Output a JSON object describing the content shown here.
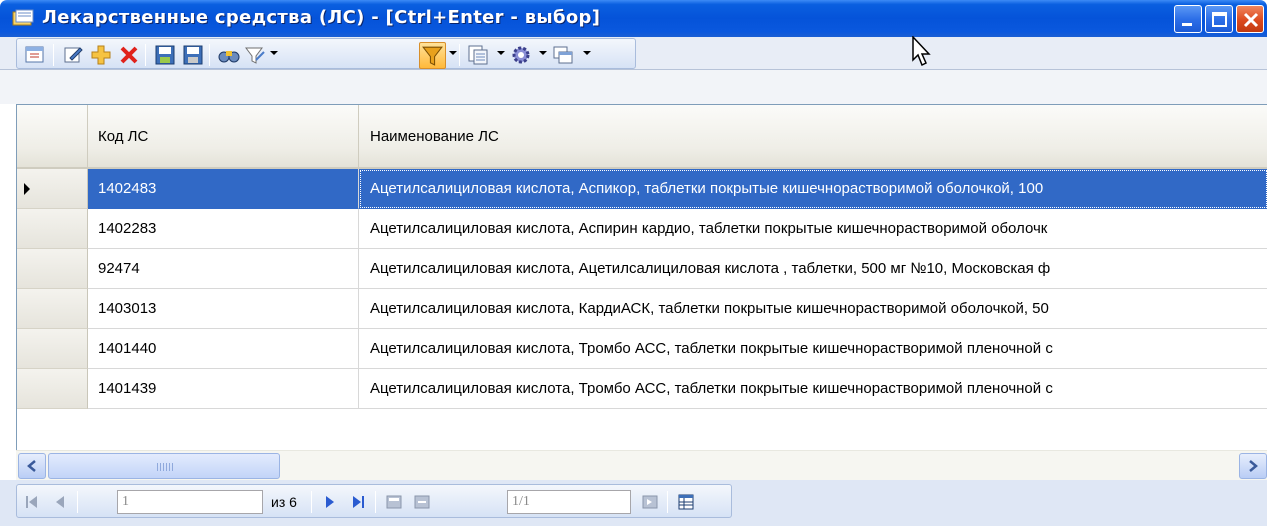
{
  "window": {
    "title": "Лекарственные средства (ЛС) - [Ctrl+Enter - выбор]"
  },
  "toolbar": {
    "items": [
      "refresh-icon",
      "edit-icon",
      "add-icon",
      "delete-icon",
      "save-icon",
      "save-as-icon",
      "find-icon",
      "filter-edit-icon",
      "filter-icon",
      "copy-icon",
      "settings-icon",
      "windows-icon"
    ],
    "filter_active": true
  },
  "grid": {
    "columns": [
      "Код ЛС",
      "Наименование ЛС"
    ],
    "selected_row": 0,
    "rows": [
      {
        "code": "1402483",
        "name": "Ацетилсалициловая кислота, Аспикор, таблетки покрытые кишечнорастворимой оболочкой, 100"
      },
      {
        "code": "1402283",
        "name": "Ацетилсалициловая кислота, Аспирин кардио, таблетки покрытые кишечнорастворимой оболочк"
      },
      {
        "code": "92474",
        "name": "Ацетилсалициловая кислота, Ацетилсалициловая кислота , таблетки, 500 мг №10, Московская ф"
      },
      {
        "code": "1403013",
        "name": "Ацетилсалициловая кислота, КардиАСК, таблетки покрытые кишечнорастворимой оболочкой, 50"
      },
      {
        "code": "1401440",
        "name": "Ацетилсалициловая кислота, Тромбо АСС, таблетки покрытые кишечнорастворимой пленочной с"
      },
      {
        "code": "1401439",
        "name": "Ацетилсалициловая кислота, Тромбо АСС, таблетки покрытые кишечнорастворимой пленочной с"
      }
    ]
  },
  "navigator": {
    "current_page": "1",
    "of_label": "из 6",
    "record_position": "1/1"
  },
  "colors": {
    "titlebar": "#0553d9",
    "selection": "#3169c6",
    "filter_active": "#ffb93b"
  }
}
